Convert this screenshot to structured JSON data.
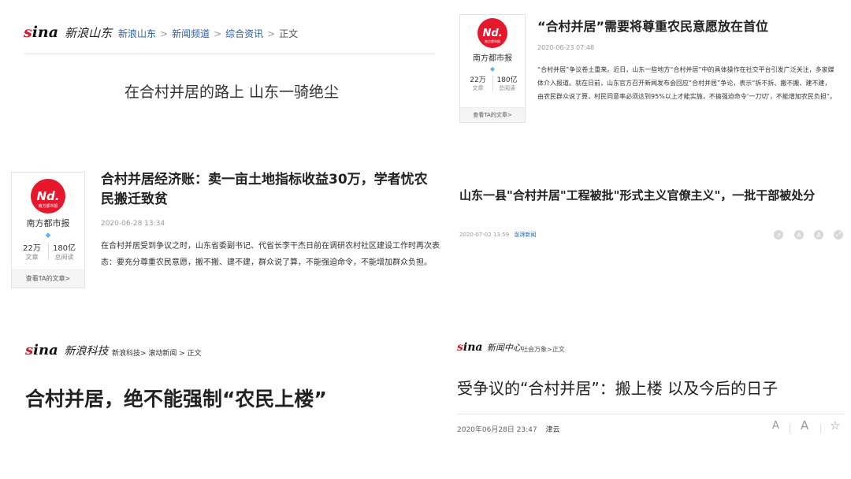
{
  "panel1": {
    "logo": {
      "s": "s",
      "rest": "ina",
      "cn": "新浪山东"
    },
    "breadcrumb": [
      "新浪山东",
      "新闻频道",
      "综合资讯",
      "正文"
    ],
    "title": "在合村并居的路上 山东一骑绝尘"
  },
  "panel2": {
    "card": {
      "logo_text": "Nd.",
      "logo_sub": "南方都市报",
      "name": "南方都市报",
      "articles_num": "22万",
      "articles_lbl": "文章",
      "views_num": "180亿",
      "views_lbl": "总阅读",
      "footer": "查看TA的文章>"
    },
    "title": "“合村并居”需要将尊重农民意愿放在首位",
    "date": "2020-06-23 07:48",
    "body": "“合村并居”争议卷土重来。近日，山东一些地方“合村并居”中的具体操作在社交平台引发广泛关注，多家媒体介入报道。就在日前，山东官方召开新闻发布会回应“合村并居”争论，表示“拆不拆、搬不搬、建不建，由农民群众说了算，村民同意率必须达到95%以上才能实施，不搞强迫命令‘一刀切’，不能增加农民负担”。"
  },
  "panel3": {
    "card": {
      "logo_text": "Nd.",
      "logo_sub": "南方都市报",
      "name": "南方都市报",
      "articles_num": "22万",
      "articles_lbl": "文章",
      "views_num": "180亿",
      "views_lbl": "总阅读",
      "footer": "查看TA的文章>"
    },
    "title": "合村并居经济账：卖一亩土地指标收益30万，学者忧农民搬迁致贫",
    "date": "2020-06-28 13:34",
    "body": "在合村并居受到争议之时，山东省委副书记、代省长李干杰日前在调研农村社区建设工作时再次表态：要充分尊重农民意愿，搬不搬、建不建，群众说了算，不能强迫命令，不能增加群众负担。"
  },
  "panel4": {
    "title": "山东一县\"合村并居\"工程被批\"形式主义官僚主义\"，一批干部被处分",
    "date": "2020-07-02 13:59",
    "source": "澎湃新闻"
  },
  "panel5": {
    "logo": {
      "s": "s",
      "rest": "ina",
      "cn": "新浪科技"
    },
    "breadcrumb": "新浪科技> 滚动新闻 > 正文",
    "title": "合村并居，绝不能强制“农民上楼”"
  },
  "panel6": {
    "logo": {
      "s": "s",
      "rest": "ina",
      "cn": "新闻中心"
    },
    "breadcrumb": "社会万象>正文",
    "title": "受争议的“合村并居”：搬上楼 以及今后的日子",
    "date": "2020年06月28日 23:47",
    "source": "津云",
    "tools": {
      "font_small": "A",
      "font_large": "A",
      "star": "☆"
    }
  },
  "colors": {
    "brand_red": "#d4172c",
    "link_blue": "#2b5fa8"
  }
}
